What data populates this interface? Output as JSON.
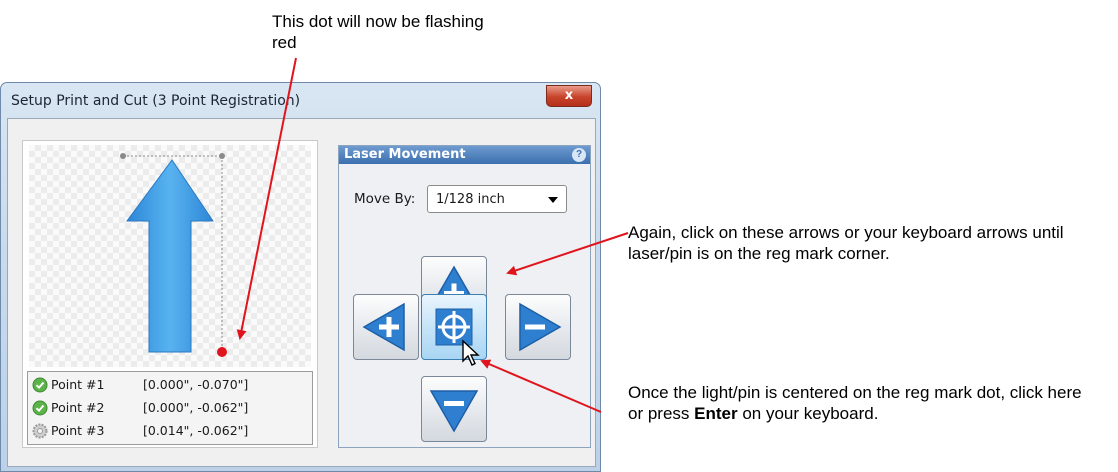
{
  "annotations": {
    "top": "This dot will now be flashing red",
    "right": "Again, click on these arrows or your keyboard arrows until laser/pin is on the reg mark corner.",
    "bottom_before": "Once the light/pin is centered on the reg mark dot, click here or press ",
    "bottom_bold": "Enter",
    "bottom_after": " on your keyboard."
  },
  "window": {
    "title": "Setup Print and Cut (3 Point Registration)",
    "close_label": "x"
  },
  "points": [
    {
      "label": "Point #1",
      "value": "[0.000\", -0.070\"]",
      "icon": "check-icon"
    },
    {
      "label": "Point #2",
      "value": "[0.000\", -0.062\"]",
      "icon": "check-icon"
    },
    {
      "label": "Point #3",
      "value": "[0.014\", -0.062\"]",
      "icon": "gear-icon"
    }
  ],
  "laser": {
    "title": "Laser Movement",
    "help_label": "?",
    "move_by_label": "Move By:",
    "move_by_value": "1/128 inch"
  },
  "colors": {
    "arrow_blue": "#3d9be0",
    "reg_dot": "#e0141c",
    "annotation_arrow": "#e0141c"
  }
}
